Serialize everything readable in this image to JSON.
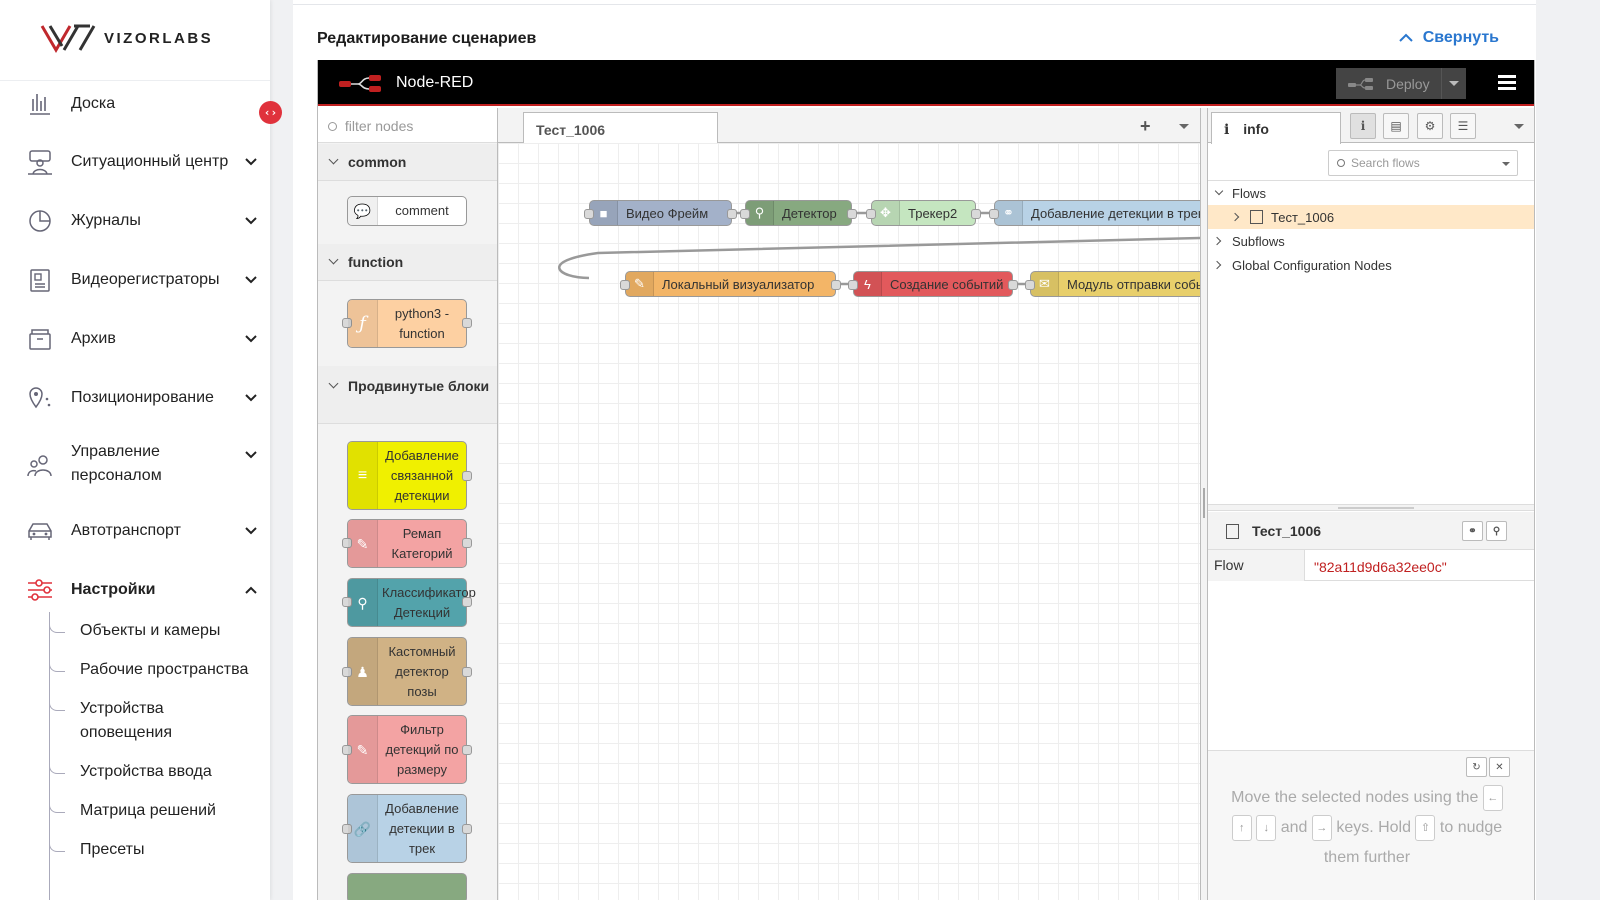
{
  "sidebar": {
    "brand": "VIZORLABS",
    "items": [
      {
        "label": "Доска",
        "icon": "dashboard-icon",
        "has_chevron": false
      },
      {
        "label": "Ситуационный центр",
        "icon": "situation-center-icon",
        "has_chevron": true
      },
      {
        "label": "Журналы",
        "icon": "pie-chart-icon",
        "has_chevron": true
      },
      {
        "label": "Видеорегистраторы",
        "icon": "video-recorder-icon",
        "has_chevron": true
      },
      {
        "label": "Архив",
        "icon": "archive-icon",
        "has_chevron": true
      },
      {
        "label": "Позиционирование",
        "icon": "location-pin-icon",
        "has_chevron": true
      },
      {
        "label": "Управление персоналом",
        "icon": "staff-icon",
        "has_chevron": true
      },
      {
        "label": "Автотранспорт",
        "icon": "car-icon",
        "has_chevron": true
      },
      {
        "label": "Настройки",
        "icon": "settings-sliders-icon",
        "has_chevron": true,
        "active": true
      }
    ],
    "settings_subitems": [
      "Объекты и камеры",
      "Рабочие пространства",
      "Устройства оповещения",
      "Устройства ввода",
      "Матрица решений",
      "Пресеты"
    ],
    "collapse_glyph": "‹›"
  },
  "card": {
    "title": "Редактирование сценариев",
    "collapse_label": "Свернуть"
  },
  "nodered": {
    "brand": "Node-RED",
    "deploy_label": "Deploy",
    "palette": {
      "filter_placeholder": "filter nodes",
      "categories": [
        "common",
        "function",
        "Продвинутые блоки"
      ],
      "nodes": [
        {
          "label": "comment",
          "color": "#ffffff"
        },
        {
          "label": "python3 - function",
          "color": "#fdd0a2"
        },
        {
          "label": "Добавление связанной детекции",
          "color": "#f0f000"
        },
        {
          "label": "Ремап Категорий",
          "color": "#f3a3a3"
        },
        {
          "label": "Классификатор Детекций",
          "color": "#53a3ab"
        },
        {
          "label": "Кастомный детектор позы",
          "color": "#d0b285"
        },
        {
          "label": "Фильтр детекций по размеру",
          "color": "#f3a3a3"
        },
        {
          "label": "Добавление детекции в трек",
          "color": "#b8d2e6"
        }
      ]
    },
    "workspace": {
      "tab_label": "Тест_1006",
      "flow_nodes": [
        {
          "label": "Видео Фрейм",
          "color": "#a3b1c9",
          "icon": "video-camera-icon"
        },
        {
          "label": "Детектор",
          "color": "#87a980",
          "icon": "magnifier-icon"
        },
        {
          "label": "Трекер2",
          "color": "#c5e6c0",
          "icon": "tracker-icon"
        },
        {
          "label": "Добавление детекции в трек",
          "color": "#b8d2e6",
          "icon": "link-icon"
        },
        {
          "label": "Локальный визуализатор",
          "color": "#f3b567",
          "icon": "brush-icon"
        },
        {
          "label": "Создание событий",
          "color": "#e2595c",
          "icon": "lightning-icon"
        },
        {
          "label": "Модуль отправки событий",
          "color": "#e8cf6b",
          "icon": "envelope-icon"
        }
      ]
    },
    "info": {
      "tab_label": "info",
      "search_placeholder": "Search flows",
      "tree": {
        "flows_label": "Flows",
        "flow_item": "Тест_1006",
        "subflows_label": "Subflows",
        "global_label": "Global Configuration Nodes"
      },
      "props_title": "Тест_1006",
      "props_key": "Flow",
      "props_value": "\"82a11d9d6a32ee0c\"",
      "tip": {
        "t1": "Move the selected nodes using the",
        "k_left": "←",
        "k_up": "↑",
        "k_down": "↓",
        "t2": "and",
        "k_right": "→",
        "t3": "keys. Hold",
        "k_shift": "⇧",
        "t4": "to nudge them further"
      }
    }
  },
  "colors": {
    "accent_red": "#e0323c",
    "link_blue": "#2a77cf",
    "nodered_header": "#000000",
    "nodered_header_border": "#c02020"
  }
}
